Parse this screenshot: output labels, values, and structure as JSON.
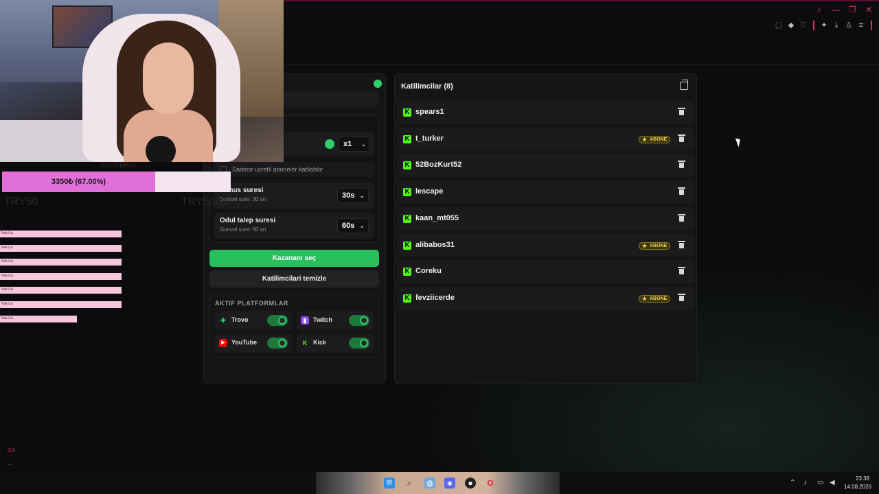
{
  "webcam": {
    "overlay_label": "SKORMAN"
  },
  "goal": {
    "progress_text": "3350₺ (67.00%)",
    "progress_fraction": 0.67,
    "min_label": "TRY50",
    "max_label": "TRY5000"
  },
  "chat": {
    "names": [
      "Nak Liu",
      "Nak Liu",
      "Nak Liu",
      "Nak Liu",
      "Nak Liu",
      "Nak Liu",
      "Nak Liu"
    ]
  },
  "side": {
    "gx": "GX",
    "more": "..."
  },
  "settings": {
    "multiplier": "x1",
    "sub_only_label": "Sadece ucretli aboneler katilabilir",
    "timers": [
      {
        "title": "Bonus suresi",
        "subtitle": "Guncel sure: 30 sn",
        "value": "30s"
      },
      {
        "title": "Odul talep suresi",
        "subtitle": "Guncel sure: 60 sn",
        "value": "60s"
      }
    ],
    "pick_winner": "Kazananı seç",
    "clear_participants": "Katilimcilari temizle",
    "platforms_title": "AKTIF PLATFORMLAR",
    "platforms": [
      {
        "name": "Trovo",
        "enabled": true,
        "color": "#19d66b"
      },
      {
        "name": "Twitch",
        "enabled": true,
        "color": "#9146ff"
      },
      {
        "name": "YouTube",
        "enabled": true,
        "color": "#ff0000"
      },
      {
        "name": "Kick",
        "enabled": true,
        "color": "#53fc18"
      }
    ]
  },
  "participants": {
    "title": "Katilimcilar (8)",
    "subscriber_badge": "ABONE",
    "list": [
      {
        "name": "spears1",
        "subscriber": false
      },
      {
        "name": "t_turker",
        "subscriber": true
      },
      {
        "name": "52BozKurt52",
        "subscriber": false
      },
      {
        "name": "lescape",
        "subscriber": false
      },
      {
        "name": "kaan_mt055",
        "subscriber": false
      },
      {
        "name": "alibabos31",
        "subscriber": true
      },
      {
        "name": "Coreku",
        "subscriber": false
      },
      {
        "name": "fevziicerde",
        "subscriber": true
      }
    ]
  },
  "taskbar": {
    "time": "23:38",
    "date": "14.08.2026"
  },
  "colors": {
    "accent_green": "#27c05f",
    "kick_green": "#53fc18",
    "browser_red": "#d8356a",
    "badge_gold": "#f2d34b"
  }
}
